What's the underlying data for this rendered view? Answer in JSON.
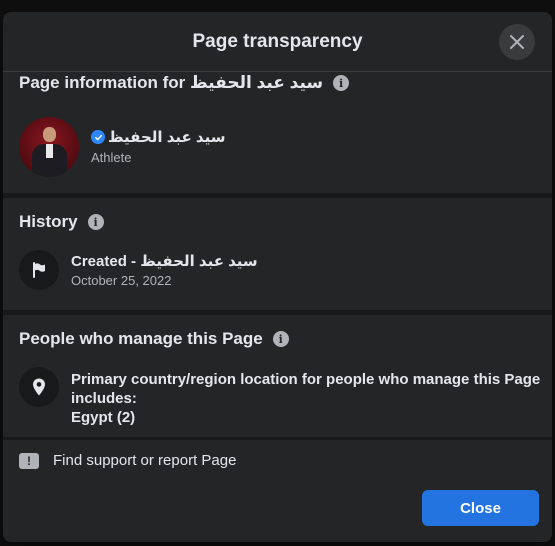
{
  "modal": {
    "title": "Page transparency",
    "close_button_label": "Close"
  },
  "page_info": {
    "title": "Page information for سيد عبد الحفيظ",
    "page_name": "سيد عبد الحفيظ",
    "category": "Athlete"
  },
  "history": {
    "title": "History",
    "created_label": "Created - سيد عبد الحفيظ",
    "created_date": "October 25, 2022"
  },
  "managers": {
    "title": "People who manage this Page",
    "line1": "Primary country/region location for people who manage this Page",
    "line2": "includes:",
    "country": "Egypt (2)"
  },
  "footer": {
    "support_link": "Find support or report Page"
  },
  "colors": {
    "accent": "#2374e1",
    "verified": "#2d88ff",
    "surface": "#242526"
  }
}
